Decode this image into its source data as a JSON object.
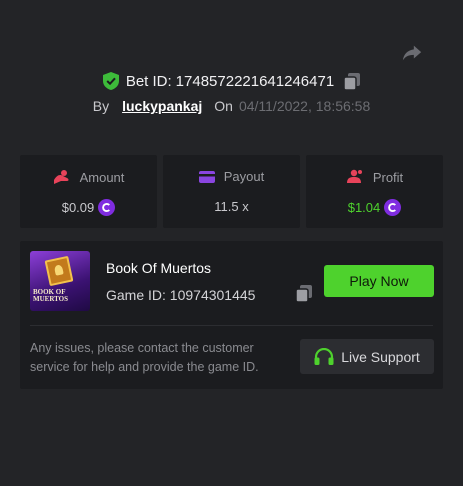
{
  "header": {
    "bet_label": "Bet ID:",
    "bet_id": "1748572221641246471",
    "by_label": "By",
    "username": "luckypankaj",
    "on_label": "On",
    "datetime": "04/11/2022, 18:56:58"
  },
  "stats": {
    "amount": {
      "label": "Amount",
      "value": "$0.09"
    },
    "payout": {
      "label": "Payout",
      "value": "11.5 x"
    },
    "profit": {
      "label": "Profit",
      "value": "$1.04"
    }
  },
  "game": {
    "thumbnail_title": "BOOK OF MUERTOS",
    "name": "Book Of Muertos",
    "id_label": "Game ID:",
    "id": "10974301445",
    "play_label": "Play Now"
  },
  "support": {
    "message": "Any issues, please contact the customer service for help and provide the game ID.",
    "button_label": "Live Support"
  },
  "colors": {
    "background": "#232427",
    "card": "#1b1c1f",
    "accent_green": "#4ed22d",
    "coin_purple": "#7f2ce0",
    "amount_icon": "#e8435a",
    "payout_icon": "#8a45e0",
    "profit_icon": "#e8435a"
  },
  "icons": [
    "share-icon",
    "shield-check-icon",
    "copy-icon",
    "amount-icon",
    "payout-icon",
    "profit-icon",
    "coin-icon",
    "headset-icon"
  ]
}
